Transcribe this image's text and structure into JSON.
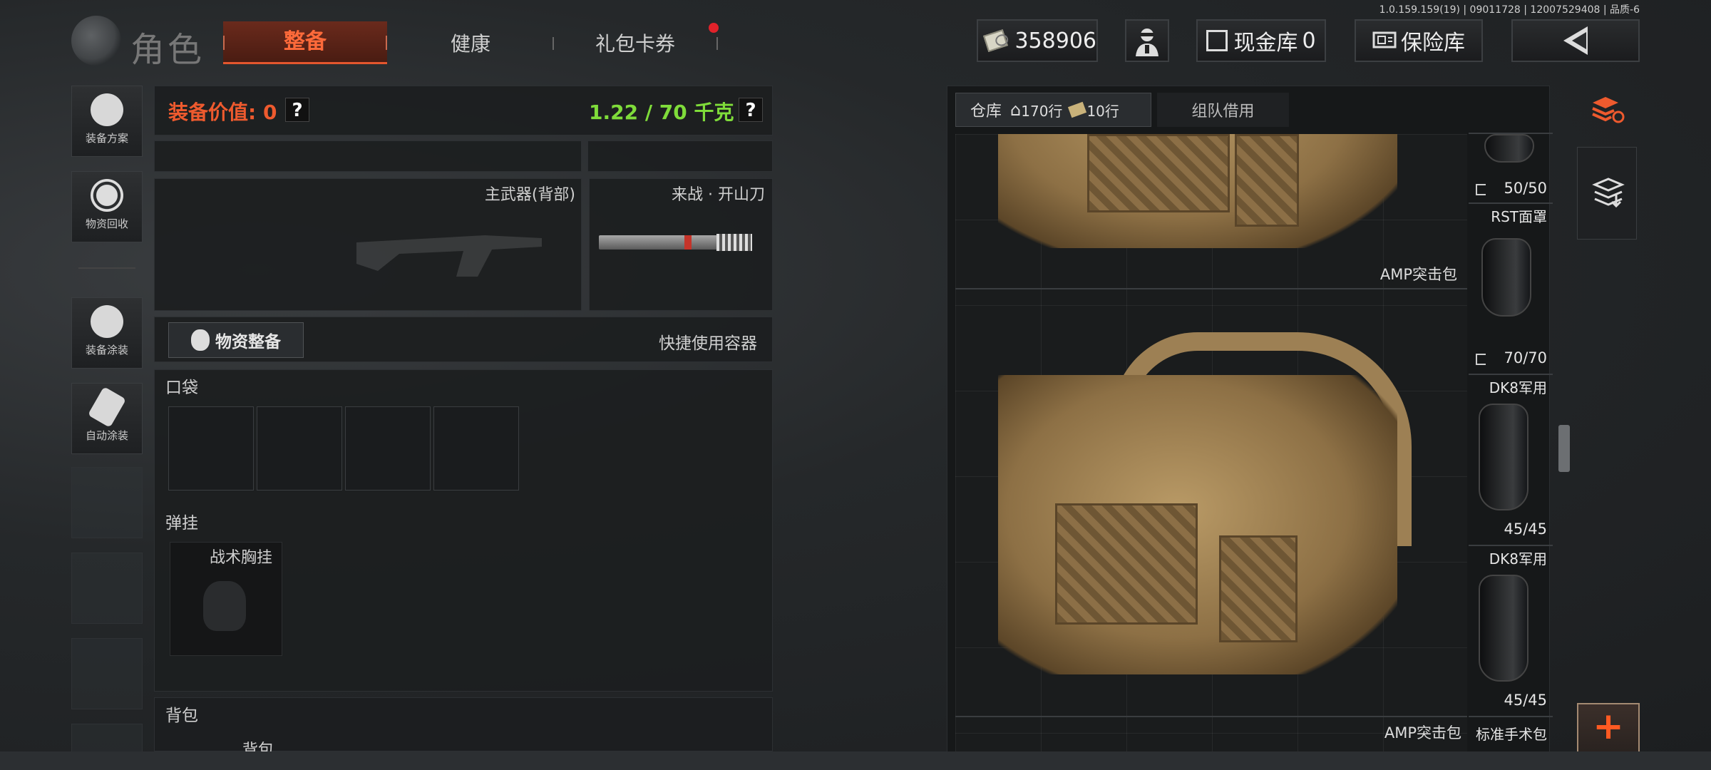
{
  "version_info": "1.0.159.159(19) | 09011728 | 12007529408 | 品质-6",
  "header": {
    "title": "角色",
    "tabs": [
      {
        "label": "整备",
        "active": true
      },
      {
        "label": "健康",
        "active": false
      },
      {
        "label": "礼包卡券",
        "active": false,
        "notification": true
      }
    ],
    "currency": "358906",
    "cash_vault_label": "现金库",
    "cash_vault_count": "0",
    "safe_label": "保险库"
  },
  "sidebar": {
    "items": [
      {
        "label": "装备方案",
        "icon": "loadout-icon"
      },
      {
        "label": "物资回收",
        "icon": "recycle-icon"
      },
      {
        "label": "装备涂装",
        "icon": "paint-icon"
      },
      {
        "label": "自动涂装",
        "icon": "auto-paint-icon"
      }
    ]
  },
  "loadout": {
    "value_label": "装备价值:",
    "value": "0",
    "weight": "1.22 / 70 千克",
    "help": "?",
    "primary_slot_label": "主武器(背部)",
    "melee_slot_label": "来战 · 开山刀",
    "supply_button": "物资整备",
    "quick_container_label": "快捷使用容器",
    "pockets_label": "口袋",
    "rig_label": "弹挂",
    "rig_slot_label": "战术胸挂",
    "backpack_label": "背包",
    "backpack_slot_label": "背包"
  },
  "warehouse": {
    "tab_label": "仓库",
    "rows_home": "170行",
    "rows_paid": "10行",
    "team_borrow_label": "组队借用",
    "items": [
      {
        "name": "AMP突击包"
      },
      {
        "name": "AMP突击包"
      }
    ],
    "side_items": [
      {
        "name": "",
        "durability": "50/50"
      },
      {
        "name": "RST面罩",
        "durability": "70/70"
      },
      {
        "name": "DK8军用",
        "durability": "45/45"
      },
      {
        "name": "DK8军用",
        "durability": "45/45"
      },
      {
        "name": "标准手术包",
        "durability": ""
      }
    ]
  },
  "colors": {
    "accent": "#ee5a2e",
    "weight_ok": "#7fdc3a"
  }
}
